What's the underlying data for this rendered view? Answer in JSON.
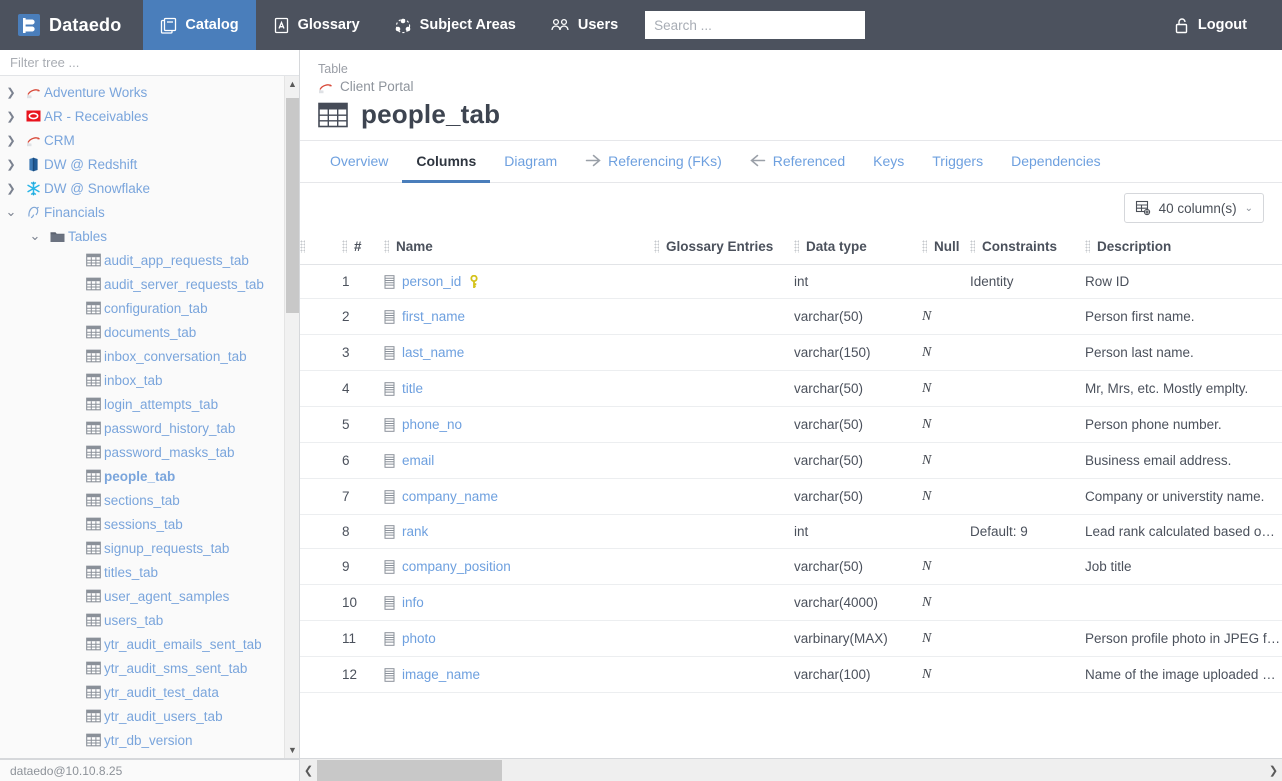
{
  "topnav": {
    "brand": "Dataedo",
    "brand_logo_icon": "dataedo-logo-icon",
    "items": [
      {
        "label": "Catalog",
        "icon": "catalog-book-icon",
        "active": true
      },
      {
        "label": "Glossary",
        "icon": "glossary-a-icon",
        "active": false
      },
      {
        "label": "Subject Areas",
        "icon": "subject-areas-nodes-icon",
        "active": false
      },
      {
        "label": "Users",
        "icon": "users-people-icon",
        "active": false
      }
    ],
    "search": {
      "placeholder": "Search ...",
      "value": ""
    },
    "logout": {
      "label": "Logout",
      "icon": "unlock-padlock-icon"
    },
    "active_color": "#4a7ebb",
    "bar_color": "#4c525e"
  },
  "sidebar": {
    "filter": {
      "placeholder": "Filter tree ...",
      "value": ""
    },
    "status": "dataedo@10.10.8.25",
    "tree": [
      {
        "label": "Adventure Works",
        "level": 1,
        "caret": "right",
        "icon": "sql-server-icon",
        "selected": false
      },
      {
        "label": "AR - Receivables",
        "level": 1,
        "caret": "right",
        "icon": "oracle-icon",
        "selected": false
      },
      {
        "label": "CRM",
        "level": 1,
        "caret": "right",
        "icon": "sql-server-icon",
        "selected": false
      },
      {
        "label": "DW @ Redshift",
        "level": 1,
        "caret": "right",
        "icon": "redshift-icon",
        "selected": false
      },
      {
        "label": "DW @ Snowflake",
        "level": 1,
        "caret": "right",
        "icon": "snowflake-icon",
        "selected": false
      },
      {
        "label": "Financials",
        "level": 1,
        "caret": "down",
        "icon": "postgres-icon",
        "selected": false
      },
      {
        "label": "Tables",
        "level": 2,
        "caret": "down",
        "icon": "folder-icon",
        "selected": false
      },
      {
        "label": "audit_app_requests_tab",
        "level": 3,
        "caret": "none",
        "icon": "table-icon",
        "selected": false
      },
      {
        "label": "audit_server_requests_tab",
        "level": 3,
        "caret": "none",
        "icon": "table-icon",
        "selected": false
      },
      {
        "label": "configuration_tab",
        "level": 3,
        "caret": "none",
        "icon": "table-icon",
        "selected": false
      },
      {
        "label": "documents_tab",
        "level": 3,
        "caret": "none",
        "icon": "table-icon",
        "selected": false
      },
      {
        "label": "inbox_conversation_tab",
        "level": 3,
        "caret": "none",
        "icon": "table-icon",
        "selected": false
      },
      {
        "label": "inbox_tab",
        "level": 3,
        "caret": "none",
        "icon": "table-icon",
        "selected": false
      },
      {
        "label": "login_attempts_tab",
        "level": 3,
        "caret": "none",
        "icon": "table-icon",
        "selected": false
      },
      {
        "label": "password_history_tab",
        "level": 3,
        "caret": "none",
        "icon": "table-icon",
        "selected": false
      },
      {
        "label": "password_masks_tab",
        "level": 3,
        "caret": "none",
        "icon": "table-icon",
        "selected": false
      },
      {
        "label": "people_tab",
        "level": 3,
        "caret": "none",
        "icon": "table-icon",
        "selected": true
      },
      {
        "label": "sections_tab",
        "level": 3,
        "caret": "none",
        "icon": "table-icon",
        "selected": false
      },
      {
        "label": "sessions_tab",
        "level": 3,
        "caret": "none",
        "icon": "table-icon",
        "selected": false
      },
      {
        "label": "signup_requests_tab",
        "level": 3,
        "caret": "none",
        "icon": "table-icon",
        "selected": false
      },
      {
        "label": "titles_tab",
        "level": 3,
        "caret": "none",
        "icon": "table-icon",
        "selected": false
      },
      {
        "label": "user_agent_samples",
        "level": 3,
        "caret": "none",
        "icon": "table-icon",
        "selected": false
      },
      {
        "label": "users_tab",
        "level": 3,
        "caret": "none",
        "icon": "table-icon",
        "selected": false
      },
      {
        "label": "ytr_audit_emails_sent_tab",
        "level": 3,
        "caret": "none",
        "icon": "table-icon",
        "selected": false
      },
      {
        "label": "ytr_audit_sms_sent_tab",
        "level": 3,
        "caret": "none",
        "icon": "table-icon",
        "selected": false
      },
      {
        "label": "ytr_audit_test_data",
        "level": 3,
        "caret": "none",
        "icon": "table-icon",
        "selected": false
      },
      {
        "label": "ytr_audit_users_tab",
        "level": 3,
        "caret": "none",
        "icon": "table-icon",
        "selected": false
      },
      {
        "label": "ytr_db_version",
        "level": 3,
        "caret": "none",
        "icon": "table-icon",
        "selected": false
      }
    ]
  },
  "page": {
    "kicker": "Table",
    "breadcrumb": "Client Portal",
    "breadcrumb_icon": "sql-server-icon",
    "title": "people_tab",
    "title_icon": "table-icon"
  },
  "tabs": [
    {
      "label": "Overview",
      "icon": "",
      "active": false
    },
    {
      "label": "Columns",
      "icon": "",
      "active": true
    },
    {
      "label": "Diagram",
      "icon": "",
      "active": false
    },
    {
      "label": "Referencing (FKs)",
      "icon": "referencing-arrow-icon",
      "active": false
    },
    {
      "label": "Referenced",
      "icon": "referenced-arrow-icon",
      "active": false
    },
    {
      "label": "Keys",
      "icon": "",
      "active": false
    },
    {
      "label": "Triggers",
      "icon": "",
      "active": false
    },
    {
      "label": "Dependencies",
      "icon": "",
      "active": false
    }
  ],
  "toolbar": {
    "column_count_label": "40 column(s)",
    "column_count_icon": "table-settings-icon",
    "chevron_icon": "chevron-down-icon"
  },
  "grid": {
    "headers": [
      "",
      "#",
      "Name",
      "Glossary Entries",
      "Data type",
      "Null",
      "Constraints",
      "Description"
    ],
    "rows": [
      {
        "num": "1",
        "name": "person_id",
        "key": true,
        "glossary": "",
        "datatype": "int",
        "null": "",
        "constraints": "Identity",
        "description": "Row ID"
      },
      {
        "num": "2",
        "name": "first_name",
        "key": false,
        "glossary": "",
        "datatype": "varchar(50)",
        "null": "N",
        "constraints": "",
        "description": "Person first name."
      },
      {
        "num": "3",
        "name": "last_name",
        "key": false,
        "glossary": "",
        "datatype": "varchar(150)",
        "null": "N",
        "constraints": "",
        "description": "Person last name."
      },
      {
        "num": "4",
        "name": "title",
        "key": false,
        "glossary": "",
        "datatype": "varchar(50)",
        "null": "N",
        "constraints": "",
        "description": "Mr, Mrs, etc. Mostly emplty."
      },
      {
        "num": "5",
        "name": "phone_no",
        "key": false,
        "glossary": "",
        "datatype": "varchar(50)",
        "null": "N",
        "constraints": "",
        "description": "Person phone number."
      },
      {
        "num": "6",
        "name": "email",
        "key": false,
        "glossary": "",
        "datatype": "varchar(50)",
        "null": "N",
        "constraints": "",
        "description": "Business email address."
      },
      {
        "num": "7",
        "name": "company_name",
        "key": false,
        "glossary": "",
        "datatype": "varchar(50)",
        "null": "N",
        "constraints": "",
        "description": "Company or universtity name."
      },
      {
        "num": "8",
        "name": "rank",
        "key": false,
        "glossary": "",
        "datatype": "int",
        "null": "",
        "constraints": "Default: 9",
        "description": "Lead rank calculated based on profile an …"
      },
      {
        "num": "9",
        "name": "company_position",
        "key": false,
        "glossary": "",
        "datatype": "varchar(50)",
        "null": "N",
        "constraints": "",
        "description": "Job title"
      },
      {
        "num": "10",
        "name": "info",
        "key": false,
        "glossary": "",
        "datatype": "varchar(4000)",
        "null": "N",
        "constraints": "",
        "description": ""
      },
      {
        "num": "11",
        "name": "photo",
        "key": false,
        "glossary": "",
        "datatype": "varbinary(MAX)",
        "null": "N",
        "constraints": "",
        "description": "Person profile photo in JPEG format."
      },
      {
        "num": "12",
        "name": "image_name",
        "key": false,
        "glossary": "",
        "datatype": "varchar(100)",
        "null": "N",
        "constraints": "",
        "description": "Name of the image uploaded by the user."
      }
    ]
  },
  "scrollbars": {
    "left_arrow_icon": "chevron-left-icon",
    "right_arrow_icon": "chevron-right-icon",
    "up_arrow_icon": "chevron-up-icon",
    "down_arrow_icon": "chevron-down-icon"
  }
}
